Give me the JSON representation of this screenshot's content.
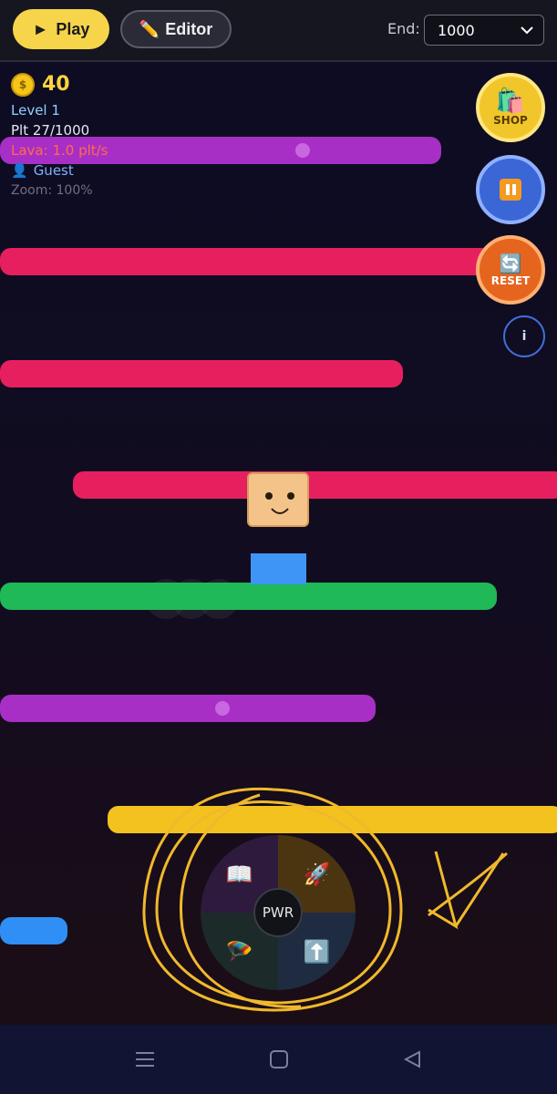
{
  "toolbar": {
    "play_label": "Play",
    "editor_label": "Editor",
    "end_label": "End:",
    "end_value": "1000"
  },
  "hud": {
    "coins": "40",
    "level": "Level 1",
    "platform": "Plt 27/1000",
    "lava": "Lava: 1.0 plt/s",
    "user": "Guest",
    "zoom": "Zoom: 100%"
  },
  "side_buttons": {
    "shop_label": "SHOP",
    "reset_label": "RESET",
    "info_label": "i"
  },
  "power_wheel": {
    "center_label": "PWR",
    "slots": [
      "book-icon",
      "rocket-icon",
      "parachute-icon",
      "up-arrow-icon"
    ]
  },
  "colors": {
    "accent": "#f7d54b",
    "platform_magenta": "#a72fc6",
    "platform_pink": "#e6205f",
    "platform_green": "#1fb957",
    "platform_yellow": "#f3c21f",
    "platform_blue": "#2f8ff5",
    "scribble": "#f0b92c"
  }
}
